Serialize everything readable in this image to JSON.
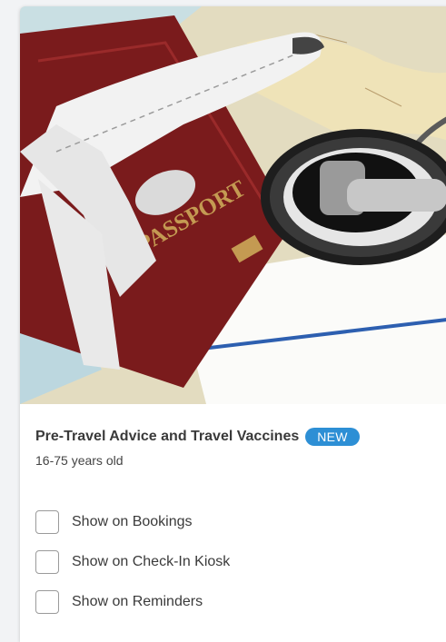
{
  "card": {
    "image_alt": "Toy airplane on a passport with a stethoscope over a world map",
    "passport_text": "PASSPORT",
    "title": "Pre-Travel Advice and Travel Vaccines",
    "badge": "NEW",
    "subtitle": "16-75 years old",
    "options": [
      {
        "label": "Show on Bookings",
        "checked": false
      },
      {
        "label": "Show on Check-In Kiosk",
        "checked": false
      },
      {
        "label": "Show on Reminders",
        "checked": false
      }
    ],
    "colors": {
      "badge": "#2d8fd5",
      "title": "#3a3a3a",
      "passport": "#7a1b1c"
    }
  }
}
